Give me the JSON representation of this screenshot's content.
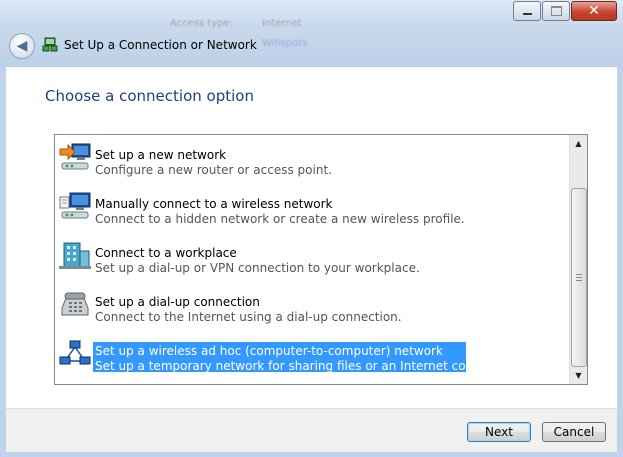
{
  "window": {
    "title": "Set Up a Connection or Network",
    "background_text": [
      "Access type:",
      "Internet",
      "Wifispots"
    ]
  },
  "heading": "Choose a connection option",
  "options": [
    {
      "title": "Set up a new network",
      "description": "Configure a new router or access point.",
      "icon": "new-network-icon"
    },
    {
      "title": "Manually connect to a wireless network",
      "description": "Connect to a hidden network or create a new wireless profile.",
      "icon": "wireless-profile-icon"
    },
    {
      "title": "Connect to a workplace",
      "description": "Set up a dial-up or VPN connection to your workplace.",
      "icon": "workplace-icon"
    },
    {
      "title": "Set up a dial-up connection",
      "description": "Connect to the Internet using a dial-up connection.",
      "icon": "dialup-phone-icon"
    },
    {
      "title": "Set up a wireless ad hoc (computer-to-computer) network",
      "description": "Set up a temporary network for sharing files or an Internet connection.",
      "icon": "adhoc-network-icon",
      "selected": true
    }
  ],
  "buttons": {
    "next": "Next",
    "cancel": "Cancel"
  },
  "colors": {
    "selection": "#3399ff",
    "heading": "#1e3f8a"
  }
}
